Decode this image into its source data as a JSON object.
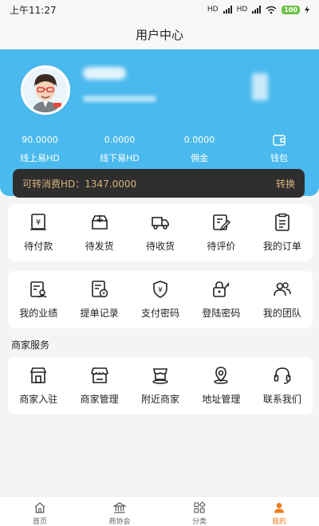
{
  "status_bar": {
    "time": "上午11:27",
    "signal_1": "HD",
    "signal_2": "HD",
    "battery": "100"
  },
  "header": {
    "title": "用户中心"
  },
  "colors": {
    "header_blue": "#4ab9ed",
    "accent_orange": "#f07d1e",
    "gold_text": "#d8b27c",
    "dark_bar": "#2e2e2e"
  },
  "stats": [
    {
      "value": "90.0000",
      "label": "线上易HD"
    },
    {
      "value": "0.0000",
      "label": "线下易HD"
    },
    {
      "value": "0.0000",
      "label": "佣金"
    },
    {
      "label": "钱包",
      "icon": "wallet-icon"
    }
  ],
  "balance": {
    "label": "可转消费HD：1347.0000",
    "action": "转换"
  },
  "orders": [
    {
      "label": "待付款",
      "icon": "pending-payment-icon"
    },
    {
      "label": "待发货",
      "icon": "pending-shipment-icon"
    },
    {
      "label": "待收货",
      "icon": "delivery-truck-icon"
    },
    {
      "label": "待评价",
      "icon": "review-edit-icon"
    },
    {
      "label": "我的订单",
      "icon": "order-list-icon"
    }
  ],
  "tools": [
    {
      "label": "我的业绩",
      "icon": "performance-icon"
    },
    {
      "label": "提单记录",
      "icon": "withdraw-record-icon"
    },
    {
      "label": "支付密码",
      "icon": "payment-shield-icon"
    },
    {
      "label": "登陆密码",
      "icon": "lock-key-icon"
    },
    {
      "label": "我的团队",
      "icon": "team-icon"
    }
  ],
  "merchant": {
    "title": "商家服务",
    "items": [
      {
        "label": "商家入驻",
        "icon": "store-join-icon"
      },
      {
        "label": "商家管理",
        "icon": "store-manage-icon"
      },
      {
        "label": "附近商家",
        "icon": "nearby-store-icon"
      },
      {
        "label": "地址管理",
        "icon": "location-pin-icon"
      },
      {
        "label": "联系我们",
        "icon": "headset-icon"
      }
    ]
  },
  "tabbar": [
    {
      "label": "首页",
      "icon": "home-icon"
    },
    {
      "label": "商协会",
      "icon": "association-icon"
    },
    {
      "label": "分类",
      "icon": "category-icon"
    },
    {
      "label": "我的",
      "icon": "profile-icon",
      "active": true
    }
  ]
}
